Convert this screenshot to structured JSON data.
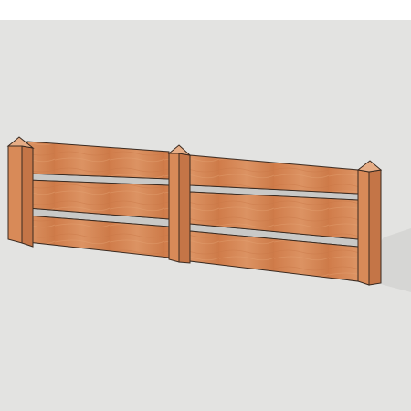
{
  "scene": {
    "model": "fence",
    "panels": 2,
    "posts": 3,
    "boards_per_panel": 3,
    "colors": {
      "sky_strip": "#ffffff",
      "ground": "#e3e3e1",
      "shadow": "#d5d5d3",
      "wood_board": "#d2824f",
      "wood_board_light": "#dd9464",
      "post_front": "#d88a58",
      "post_side": "#c07142",
      "post_cap": "#e7b08a",
      "edge": "#3a2a20",
      "gap": "#cfcfcd"
    }
  }
}
